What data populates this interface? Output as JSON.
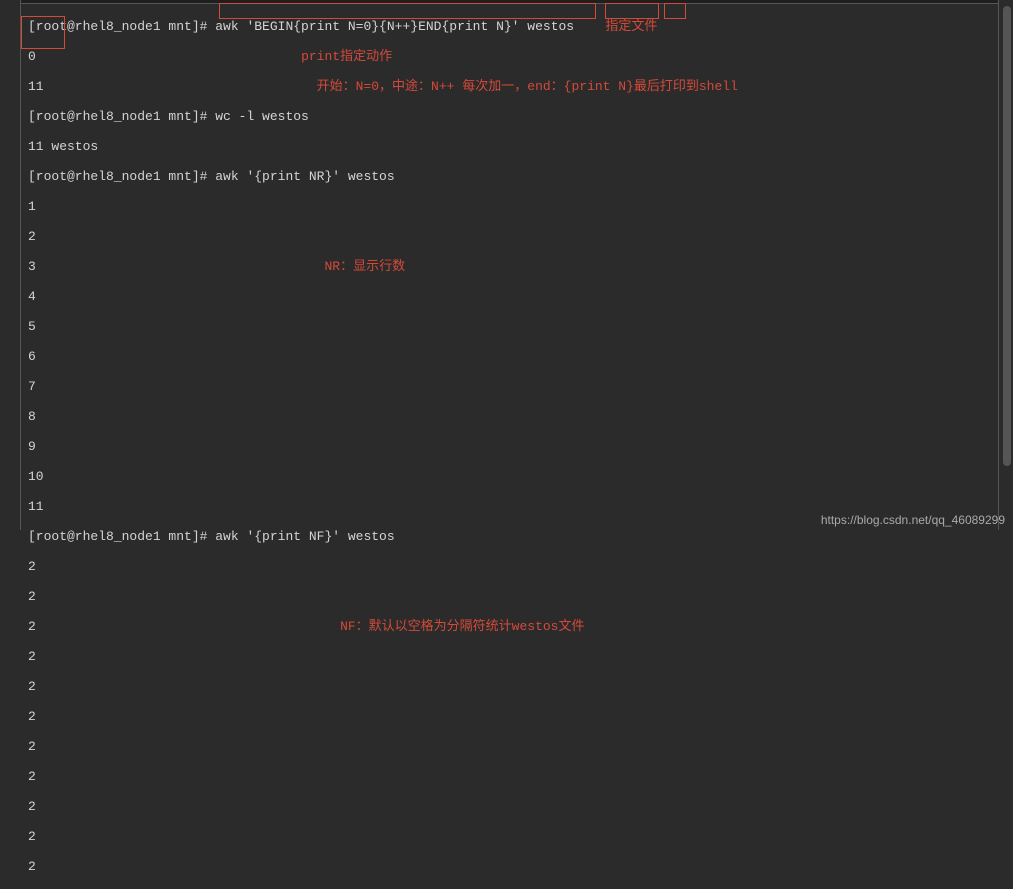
{
  "terminal": {
    "prompt": "[root@rhel8_node1 mnt]# ",
    "cmd1": "awk 'BEGIN{print N=0}{N++}END{print N}' westos",
    "out1a": "0",
    "out1b": "11",
    "cmd2": "wc -l westos",
    "out2": "11 westos",
    "cmd3": "awk '{print NR}' westos",
    "nr_out": [
      "1",
      "2",
      "3",
      "4",
      "5",
      "6",
      "7",
      "8",
      "9",
      "10",
      "11"
    ],
    "cmd4": "awk '{print NF}' westos",
    "nf_out": [
      "2",
      "2",
      "2",
      "2",
      "2",
      "2",
      "2",
      "2",
      "2",
      "2",
      "2"
    ]
  },
  "annotations": {
    "file_label": "指定文件",
    "print_label": "print指定动作",
    "begin_label": "开始：N=0，中途：N++ 每次加一，end：{print N}最后打印到shell",
    "nr_label": "NR：显示行数",
    "nf_label": "NF：默认以空格为分隔符统计westos文件"
  },
  "watermark": "https://blog.csdn.net/qq_46089299"
}
